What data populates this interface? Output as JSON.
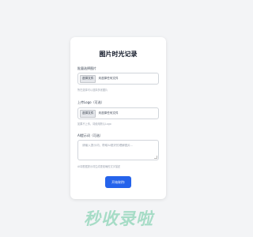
{
  "card": {
    "title": "图片时光记录"
  },
  "fields": [
    {
      "label": "批量选择图片",
      "button": "选择文件",
      "status": "未选择任何文件",
      "help": "所在选择可以选择多张图片"
    },
    {
      "label": "上传Logo（可选）",
      "button": "选择文件",
      "status": "未选择任何文件",
      "help": "如果不上传，将使用默认Logo"
    }
  ],
  "ai_prompt": {
    "label": "AI提示词（可选）",
    "placeholder": "请输入提示词，帮助AI更好的理解图片...",
    "help": "AI将根据提示词生成更准确的文字描述"
  },
  "submit_label": "开始制作",
  "watermark": "秒收录啦",
  "colors": {
    "accent": "#2563eb",
    "background": "#f3f4f6",
    "watermark": "#4abe8c"
  }
}
